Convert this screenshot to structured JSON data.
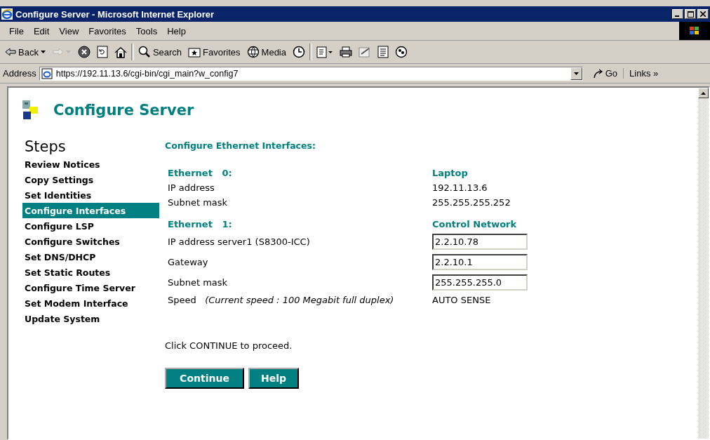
{
  "window": {
    "title": "Configure Server - Microsoft Internet Explorer"
  },
  "menu": [
    "File",
    "Edit",
    "View",
    "Favorites",
    "Tools",
    "Help"
  ],
  "toolbar": [
    {
      "kind": "back",
      "label": "Back",
      "disabled": false
    },
    {
      "kind": "forward",
      "disabled": true
    },
    {
      "kind": "stop",
      "disabled": false
    },
    {
      "kind": "refresh",
      "disabled": false
    },
    {
      "kind": "home",
      "disabled": false
    },
    {
      "kind": "separator"
    },
    {
      "kind": "search",
      "label": "Search",
      "disabled": false
    },
    {
      "kind": "favorites",
      "label": "Favorites",
      "disabled": false
    },
    {
      "kind": "media",
      "label": "Media",
      "disabled": false
    },
    {
      "kind": "history",
      "disabled": false
    },
    {
      "kind": "separator"
    },
    {
      "kind": "mail",
      "disabled": false
    },
    {
      "kind": "print",
      "disabled": false
    },
    {
      "kind": "edit",
      "disabled": false
    },
    {
      "kind": "discuss",
      "disabled": false
    },
    {
      "kind": "messenger",
      "disabled": false
    }
  ],
  "address_bar": {
    "label": "Address",
    "url": "https://192.11.13.6/cgi-bin/cgi_main?w_config7",
    "go": "Go",
    "links": "Links »"
  },
  "page": {
    "title": "Configure Server",
    "steps_heading": "Steps",
    "steps": [
      {
        "label": "Review Notices",
        "selected": false
      },
      {
        "label": "Copy Settings",
        "selected": false
      },
      {
        "label": "Set Identities",
        "selected": false
      },
      {
        "label": "Configure Interfaces",
        "selected": true
      },
      {
        "label": "Configure LSP",
        "selected": false
      },
      {
        "label": "Configure Switches",
        "selected": false
      },
      {
        "label": "Set DNS/DHCP",
        "selected": false
      },
      {
        "label": "Set Static Routes",
        "selected": false
      },
      {
        "label": "Configure Time Server",
        "selected": false
      },
      {
        "label": "Set Modem Interface",
        "selected": false
      },
      {
        "label": "Update System",
        "selected": false
      }
    ],
    "section_title": "Configure Ethernet Interfaces:",
    "interfaces": [
      {
        "heading": "Ethernet   0:",
        "column_heading": "Laptop",
        "rows": [
          {
            "kind": "text",
            "label": "IP address",
            "value": "192.11.13.6"
          },
          {
            "kind": "text",
            "label": "Subnet mask",
            "value": "255.255.255.252"
          }
        ]
      },
      {
        "heading": "Ethernet   1:",
        "column_heading": "Control Network",
        "rows": [
          {
            "kind": "input",
            "label": "IP address server1 (S8300-ICC)",
            "value": "2.2.10.78"
          },
          {
            "kind": "input",
            "label": "Gateway",
            "value": "2.2.10.1"
          },
          {
            "kind": "input",
            "label": "Subnet mask",
            "value": "255.255.255.0"
          },
          {
            "kind": "text",
            "label": "Speed",
            "note": "(Current speed : 100 Megabit full duplex)",
            "value": "AUTO SENSE"
          }
        ]
      }
    ],
    "instruction": "Click CONTINUE to proceed.",
    "buttons": [
      "Continue",
      "Help"
    ]
  }
}
